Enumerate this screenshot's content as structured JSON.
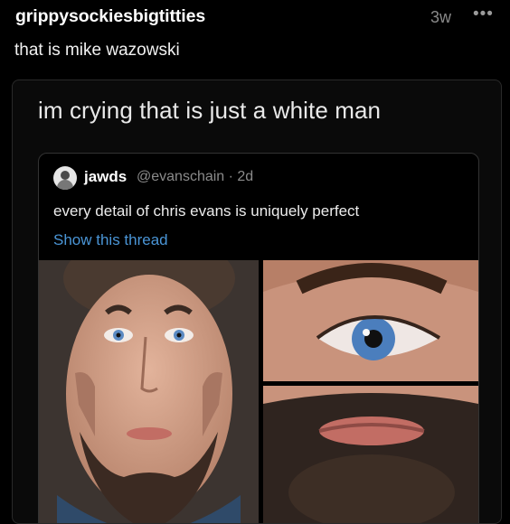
{
  "post": {
    "username": "grippysockiesbigtitties",
    "time": "3w",
    "more": "•••",
    "comment": "that is mike wazowski"
  },
  "card": {
    "text": "im crying that is just a white man",
    "quote": {
      "name": "jawds",
      "handle": "@evanschain · 2d",
      "body": "every detail of chris evans is uniquely perfect",
      "link": "Show this thread"
    }
  },
  "colors": {
    "background": "#000000",
    "link": "#4a95d6",
    "muted": "#8b8b8b"
  },
  "icons": {
    "more": "ellipsis-icon",
    "avatar": "user-avatar"
  }
}
